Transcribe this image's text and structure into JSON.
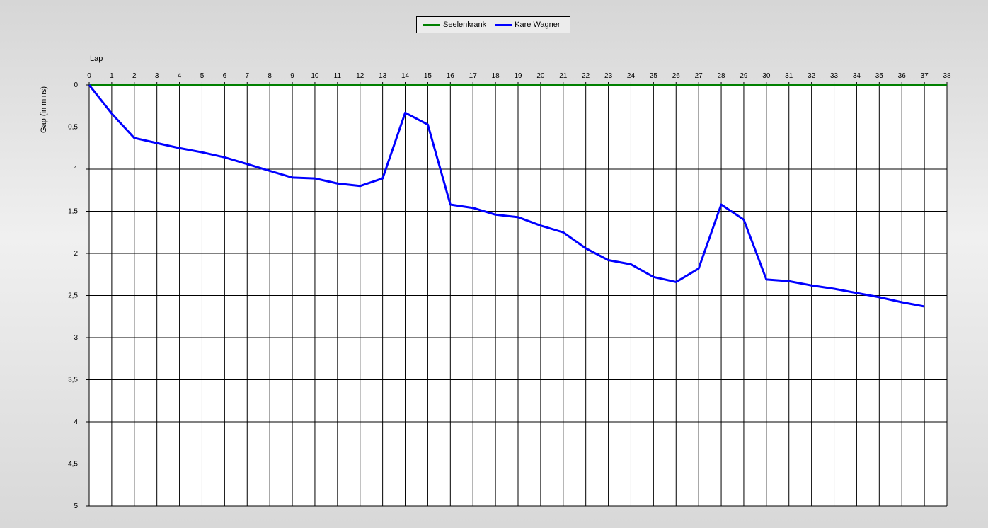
{
  "chart_data": {
    "type": "line",
    "xlabel": "Lap",
    "ylabel": "Gap (in mins)",
    "xlim": [
      0,
      38
    ],
    "ylim": [
      0,
      5
    ],
    "y_inverted": true,
    "x_ticks": [
      0,
      1,
      2,
      3,
      4,
      5,
      6,
      7,
      8,
      9,
      10,
      11,
      12,
      13,
      14,
      15,
      16,
      17,
      18,
      19,
      20,
      21,
      22,
      23,
      24,
      25,
      26,
      27,
      28,
      29,
      30,
      31,
      32,
      33,
      34,
      35,
      36,
      37,
      38
    ],
    "y_ticks": [
      0,
      0.5,
      1,
      1.5,
      2,
      2.5,
      3,
      3.5,
      4,
      4.5,
      5
    ],
    "y_tick_labels": [
      "0",
      "0,5",
      "1",
      "1,5",
      "2",
      "2,5",
      "3",
      "3,5",
      "4",
      "4,5",
      "5"
    ],
    "grid": true,
    "legend_position": "top-center",
    "series": [
      {
        "name": "Seelenkrank",
        "color": "#008000",
        "x": [
          0,
          1,
          2,
          3,
          4,
          5,
          6,
          7,
          8,
          9,
          10,
          11,
          12,
          13,
          14,
          15,
          16,
          17,
          18,
          19,
          20,
          21,
          22,
          23,
          24,
          25,
          26,
          27,
          28,
          29,
          30,
          31,
          32,
          33,
          34,
          35,
          36,
          37,
          38
        ],
        "values": [
          0,
          0,
          0,
          0,
          0,
          0,
          0,
          0,
          0,
          0,
          0,
          0,
          0,
          0,
          0,
          0,
          0,
          0,
          0,
          0,
          0,
          0,
          0,
          0,
          0,
          0,
          0,
          0,
          0,
          0,
          0,
          0,
          0,
          0,
          0,
          0,
          0,
          0,
          0
        ]
      },
      {
        "name": "Kare Wagner",
        "color": "#0000ff",
        "x": [
          0,
          1,
          2,
          3,
          4,
          5,
          6,
          7,
          8,
          9,
          10,
          11,
          12,
          13,
          14,
          15,
          16,
          17,
          18,
          19,
          20,
          21,
          22,
          23,
          24,
          25,
          26,
          27,
          28,
          29,
          30,
          31,
          32,
          33,
          34,
          35,
          36,
          37
        ],
        "values": [
          0,
          0.34,
          0.63,
          0.69,
          0.75,
          0.8,
          0.86,
          0.94,
          1.02,
          1.1,
          1.11,
          1.17,
          1.2,
          1.11,
          0.33,
          0.47,
          1.42,
          1.46,
          1.54,
          1.57,
          1.67,
          1.75,
          1.94,
          2.08,
          2.13,
          2.28,
          2.34,
          2.18,
          1.42,
          1.6,
          2.31,
          2.33,
          2.38,
          2.42,
          2.47,
          2.52,
          2.58,
          2.63
        ]
      }
    ]
  }
}
